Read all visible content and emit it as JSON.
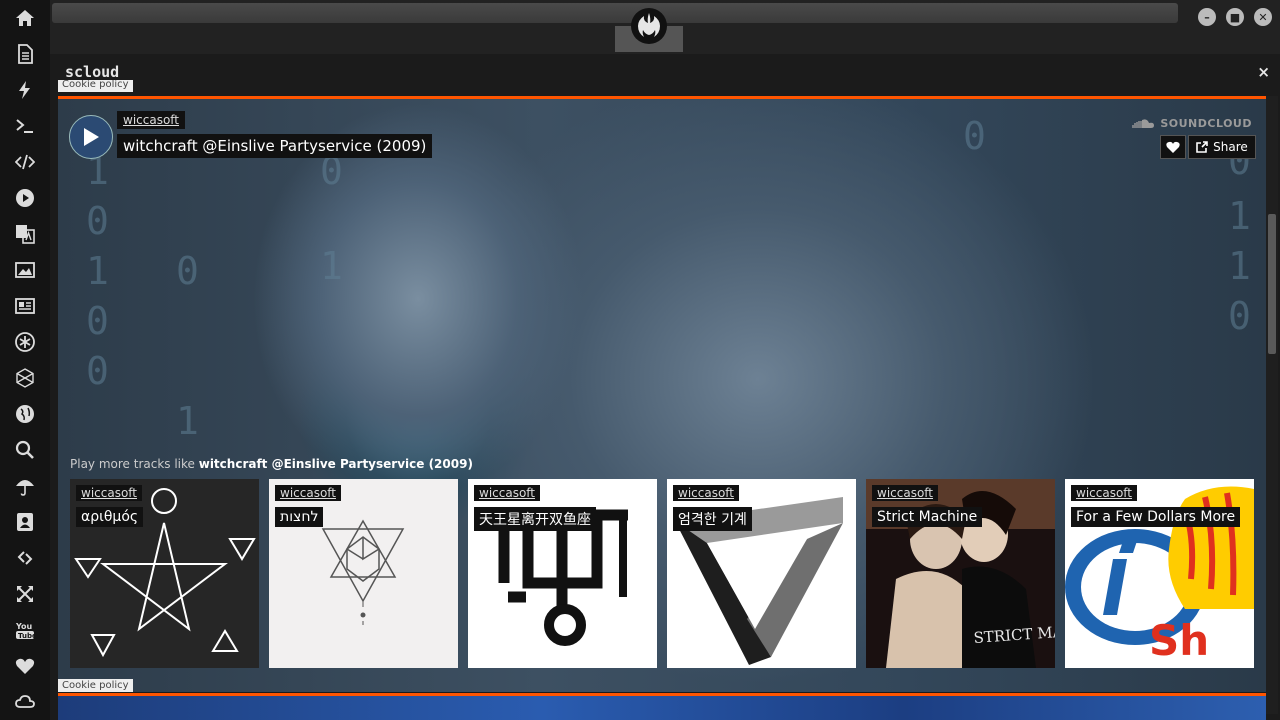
{
  "window": {
    "app_name": "scloud",
    "close_label": "×",
    "controls": [
      "minimize",
      "maximize",
      "close"
    ]
  },
  "sidebar": {
    "items": [
      {
        "name": "home-icon"
      },
      {
        "name": "document-icon"
      },
      {
        "name": "lightning-icon"
      },
      {
        "name": "terminal-icon"
      },
      {
        "name": "code-icon"
      },
      {
        "name": "play-circle-icon"
      },
      {
        "name": "translate-icon"
      },
      {
        "name": "image-icon"
      },
      {
        "name": "newspaper-icon"
      },
      {
        "name": "asterisk-icon"
      },
      {
        "name": "hexagon-icon"
      },
      {
        "name": "globe-icon"
      },
      {
        "name": "search-icon"
      },
      {
        "name": "umbrella-icon"
      },
      {
        "name": "contact-card-icon"
      },
      {
        "name": "link-icon"
      },
      {
        "name": "expand-icon"
      },
      {
        "name": "youtube-icon"
      },
      {
        "name": "heart-icon"
      },
      {
        "name": "cloud-icon"
      }
    ]
  },
  "cookie_policy": "Cookie policy",
  "player": {
    "artist": "wiccasoft",
    "track_title": "witchcraft @Einslive Partyservice (2009)",
    "soundcloud_label": "SOUNDCLOUD",
    "share_label": "Share",
    "more_prefix": "Play more tracks like ",
    "more_track": "witchcraft @Einslive Partyservice (2009)",
    "accent_color": "#ff5500"
  },
  "related_tracks": [
    {
      "artist": "wiccasoft",
      "title": "αριθμός"
    },
    {
      "artist": "wiccasoft",
      "title": "לחצות"
    },
    {
      "artist": "wiccasoft",
      "title": "天王星离开双鱼座"
    },
    {
      "artist": "wiccasoft",
      "title": "엄격한 기계"
    },
    {
      "artist": "wiccasoft",
      "title": "Strict Machine"
    },
    {
      "artist": "wiccasoft",
      "title": "For a Few Dollars More"
    }
  ],
  "artwork_text": {
    "strict_machine": "STRICT MACHINE",
    "shell_text": "Sh"
  }
}
